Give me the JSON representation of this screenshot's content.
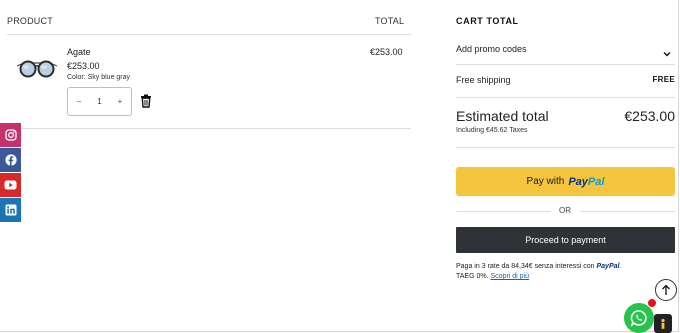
{
  "cart": {
    "col_product": "PRODUCT",
    "col_total": "TOTAL",
    "item": {
      "name": "Agate",
      "price": "€253.00",
      "variant": "Color: Sky blue gray",
      "quantity": "1",
      "line_total": "€253.00",
      "icon": "sunglasses-icon"
    }
  },
  "summary": {
    "title": "CART TOTAL",
    "promo_label": "Add promo codes",
    "shipping_label": "Free shipping",
    "shipping_value": "FREE",
    "estimated_label": "Estimated total",
    "estimated_value": "€253.00",
    "taxes_note": "Including €45.62 Taxes",
    "paypal_prefix": "Pay with",
    "paypal_pay": "Pay",
    "paypal_pal": "Pal",
    "or_label": "OR",
    "proceed_label": "Proceed to payment",
    "paylater_text": "Paga in 3 rate da 84,34€ senza interessi con",
    "paylater_brand": "PayPal",
    "paylater_taeg": "TAEG 0%.",
    "paylater_link": "Scopri di più"
  },
  "social": [
    "instagram-icon",
    "facebook-icon",
    "youtube-icon",
    "linkedin-icon"
  ],
  "colors": {
    "paypal_yellow": "#f5c53d",
    "proceed_dark": "#2f3338",
    "whatsapp_green": "#28c24f",
    "instagram": "#c3326b",
    "facebook": "#3b5998",
    "youtube": "#d62a2a",
    "linkedin": "#1b75b3"
  }
}
